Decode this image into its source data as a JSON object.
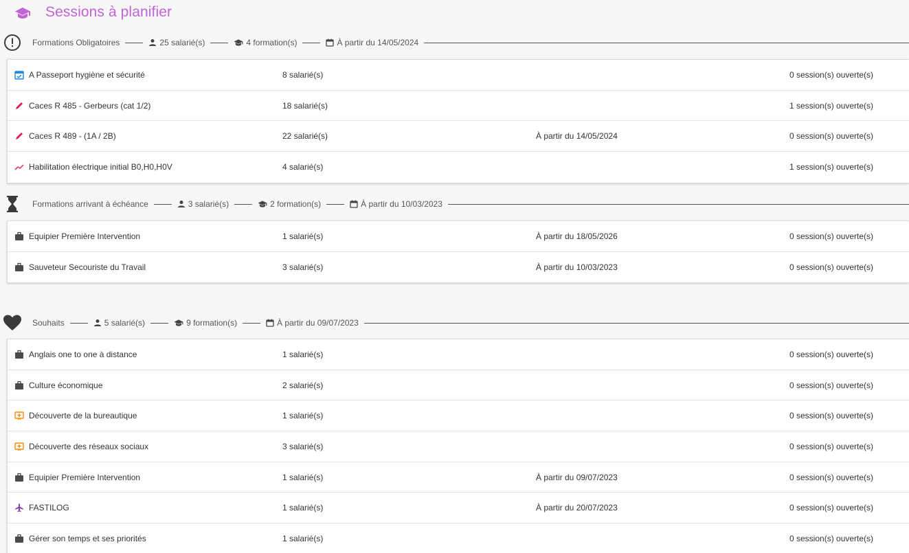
{
  "page": {
    "title": "Sessions à planifier"
  },
  "sections": [
    {
      "title": "Formations Obligatoires",
      "employees": "25 salarié(s)",
      "trainings": "4 formation(s)",
      "from": "À partir du 14/05/2024",
      "rows": [
        {
          "icon": "calendar-check-icon",
          "name": "A Passeport hygiène et sécurité",
          "employees": "8 salarié(s)",
          "date": "",
          "sessions": "0 session(s) ouverte(s)"
        },
        {
          "icon": "pencil-icon",
          "name": "Caces R 485 - Gerbeurs (cat 1/2)",
          "employees": "18 salarié(s)",
          "date": "",
          "sessions": "1 session(s) ouverte(s)"
        },
        {
          "icon": "pencil-icon",
          "name": "Caces R 489 - (1A / 2B)",
          "employees": "22 salarié(s)",
          "date": "À partir du 14/05/2024",
          "sessions": "0 session(s) ouverte(s)"
        },
        {
          "icon": "trending-up-icon",
          "name": "Habilitation électrique initial B0,H0,H0V",
          "employees": "4 salarié(s)",
          "date": "",
          "sessions": "1 session(s) ouverte(s)"
        }
      ]
    },
    {
      "title": "Formations arrivant à échéance",
      "employees": "3 salarié(s)",
      "trainings": "2 formation(s)",
      "from": "À partir du 10/03/2023",
      "rows": [
        {
          "icon": "briefcase-icon",
          "name": "Equipier Première Intervention",
          "employees": "1 salarié(s)",
          "date": "À partir du 18/05/2026",
          "sessions": "0 session(s) ouverte(s)"
        },
        {
          "icon": "briefcase-icon",
          "name": "Sauveteur Secouriste du Travail",
          "employees": "3 salarié(s)",
          "date": "À partir du 10/03/2023",
          "sessions": "0 session(s) ouverte(s)"
        }
      ]
    },
    {
      "title": "Souhaits",
      "employees": "5 salarié(s)",
      "trainings": "9 formation(s)",
      "from": "À partir du 09/07/2023",
      "rows": [
        {
          "icon": "briefcase-icon",
          "name": "Anglais one to one à distance",
          "employees": "1 salarié(s)",
          "date": "",
          "sessions": "0 session(s) ouverte(s)"
        },
        {
          "icon": "briefcase-icon",
          "name": "Culture économique",
          "employees": "2 salarié(s)",
          "date": "",
          "sessions": "0 session(s) ouverte(s)"
        },
        {
          "icon": "presentation-icon",
          "name": "Découverte de la bureautique",
          "employees": "1 salarié(s)",
          "date": "",
          "sessions": "0 session(s) ouverte(s)"
        },
        {
          "icon": "presentation-icon",
          "name": "Découverte des réseaux sociaux",
          "employees": "3 salarié(s)",
          "date": "",
          "sessions": "0 session(s) ouverte(s)"
        },
        {
          "icon": "briefcase-icon",
          "name": "Equipier Première Intervention",
          "employees": "1 salarié(s)",
          "date": "À partir du 09/07/2023",
          "sessions": "0 session(s) ouverte(s)"
        },
        {
          "icon": "airplane-icon",
          "name": "FASTILOG",
          "employees": "1 salarié(s)",
          "date": "À partir du 20/07/2023",
          "sessions": "0 session(s) ouverte(s)"
        },
        {
          "icon": "briefcase-icon",
          "name": "Gérer son temps et ses priorités",
          "employees": "1 salarié(s)",
          "date": "",
          "sessions": "0 session(s) ouverte(s)"
        }
      ]
    }
  ],
  "colors": {
    "title": "#c064d6",
    "icon_blue": "#1e88e5",
    "icon_pink": "#d81b60",
    "icon_orange": "#fb8c00",
    "icon_purple": "#8e44ad",
    "icon_dark": "#4a4a4a"
  }
}
